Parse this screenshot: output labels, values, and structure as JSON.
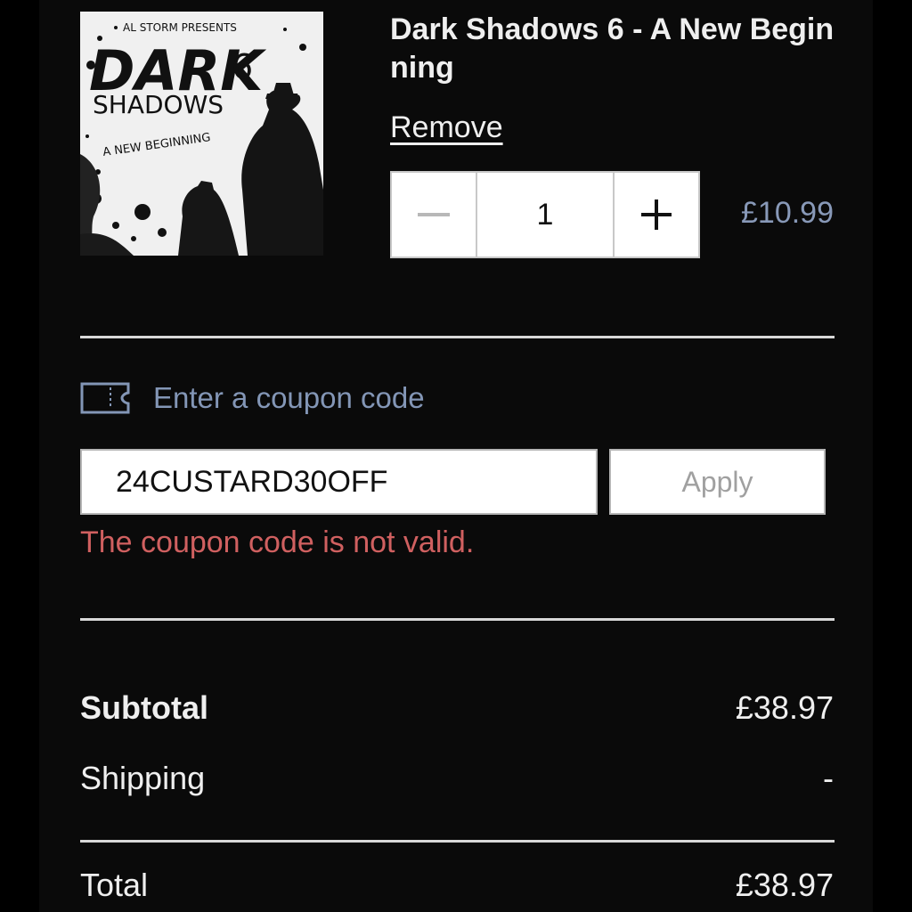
{
  "cart_item": {
    "cover": {
      "presenter": "AL STORM PRESENTS",
      "title_word_1": "DARK",
      "number": "6",
      "title_word_2": "SHADOWS",
      "subtitle": "A NEW BEGINNING"
    },
    "title": "Dark Shadows 6 - A New Beginning",
    "remove_label": "Remove",
    "quantity": "1",
    "price": "£10.99"
  },
  "coupon": {
    "toggle_label": "Enter a coupon code",
    "input_value": "24CUSTARD30OFF",
    "apply_label": "Apply",
    "error": "The coupon code is not valid."
  },
  "summary": {
    "subtotal_label": "Subtotal",
    "subtotal_value": "£38.97",
    "shipping_label": "Shipping",
    "shipping_value": "-",
    "total_label": "Total",
    "total_value": "£38.97"
  },
  "colors": {
    "background": "#0a0a0a",
    "text": "#efefef",
    "accent_muted": "#8396b6",
    "error": "#d06060"
  }
}
